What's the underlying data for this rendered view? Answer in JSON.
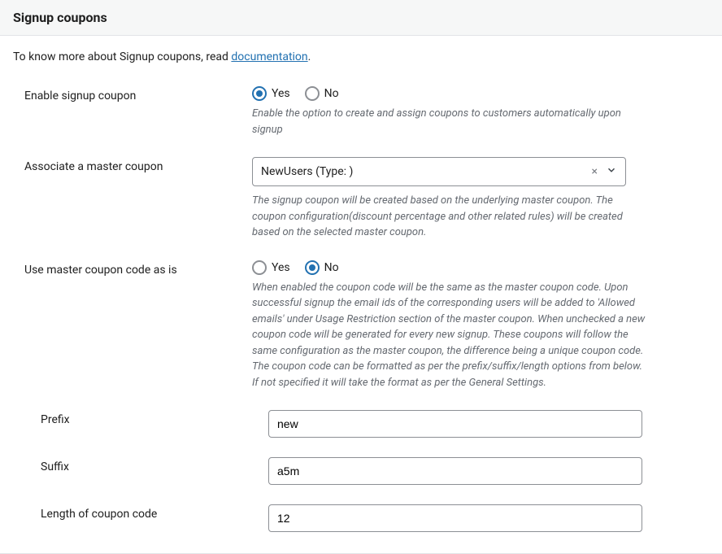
{
  "header": {
    "title": "Signup coupons"
  },
  "intro": {
    "prefix": "To know more about Signup coupons, read ",
    "link": "documentation",
    "suffix": "."
  },
  "enable": {
    "label": "Enable signup coupon",
    "yes": "Yes",
    "no": "No",
    "desc": "Enable the option to create and assign coupons to customers automatically upon signup"
  },
  "master": {
    "label": "Associate a master coupon",
    "selected": "NewUsers (Type: )",
    "desc": "The signup coupon will be created based on the underlying master coupon. The coupon configuration(discount percentage and other related rules) will be created based on the selected master coupon."
  },
  "useAsIs": {
    "label": "Use master coupon code as is",
    "yes": "Yes",
    "no": "No",
    "desc": "When enabled the coupon code will be the same as the master coupon code. Upon successful signup the email ids of the corresponding users will be added to 'Allowed emails' under Usage Restriction section of the master coupon. When unchecked a new coupon code will be generated for every new signup. These coupons will follow the same configuration as the master coupon, the difference being a unique coupon code. The coupon code can be formatted as per the prefix/suffix/length options from below. If not specified it will take the format as per the General Settings."
  },
  "prefix": {
    "label": "Prefix",
    "value": "new"
  },
  "suffix": {
    "label": "Suffix",
    "value": "a5m"
  },
  "length": {
    "label": "Length of coupon code",
    "value": "12"
  }
}
